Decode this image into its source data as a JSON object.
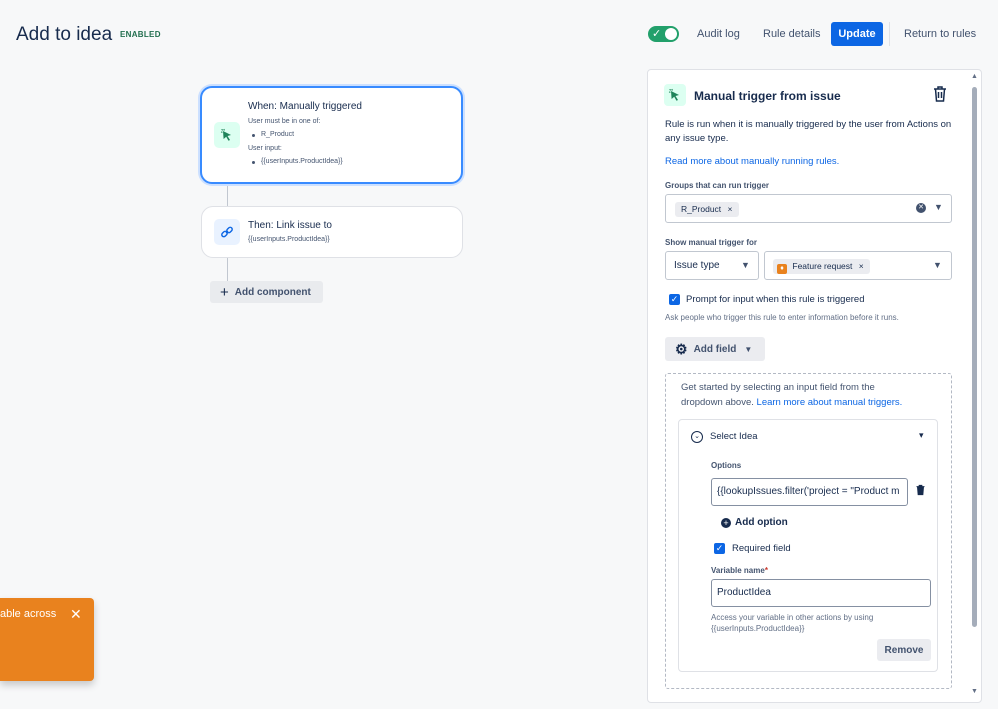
{
  "header": {
    "title": "Add to idea",
    "status": "ENABLED",
    "audit_log": "Audit log",
    "rule_details": "Rule details",
    "update": "Update",
    "return_to_rules": "Return to rules",
    "toggle_checked": true
  },
  "canvas": {
    "trigger_card": {
      "title": "When: Manually triggered",
      "line1": "User must be in one of:",
      "bullet1": "R_Product",
      "line2": "User input:",
      "bullet2": "{{userInputs.ProductIdea}}"
    },
    "action_card": {
      "title": "Then: Link issue to",
      "sub": "{{userInputs.ProductIdea}}"
    },
    "add_component": "Add component"
  },
  "toast": {
    "text": "able across"
  },
  "panel": {
    "title": "Manual trigger from issue",
    "desc": "Rule is run when it is manually triggered by the user from Actions on any issue type.",
    "read_more": "Read more about manually running rules.",
    "groups_label": "Groups that can run trigger",
    "group_tag": "R_Product",
    "show_for_label": "Show manual trigger for",
    "issue_type_select": "Issue type",
    "feature_tag": "Feature request",
    "prompt_label": "Prompt for input when this rule is triggered",
    "prompt_checked": true,
    "prompt_help": "Ask people who trigger this rule to enter information before it runs.",
    "add_field": "Add field",
    "get_started_1": "Get started by selecting an input field from the",
    "get_started_2": "dropdown above.",
    "learn_more": "Learn more about manual triggers.",
    "field": {
      "title": "Select Idea",
      "options_label": "Options",
      "option_value": "{{lookupIssues.filter('project = \"Product m",
      "add_option": "Add option",
      "required_label": "Required field",
      "required_checked": true,
      "variable_label": "Variable name",
      "required_star": "*",
      "variable_value": "ProductIdea",
      "variable_help_1": "Access your variable in other actions by using",
      "variable_help_2": "{{userInputs.ProductIdea}}",
      "remove": "Remove"
    }
  },
  "colors": {
    "primary": "#0c66e4",
    "enabled_green": "#216e4e",
    "toggle_green": "#22a06b",
    "toast_orange": "#e9821e",
    "selected_border": "#388bff"
  }
}
